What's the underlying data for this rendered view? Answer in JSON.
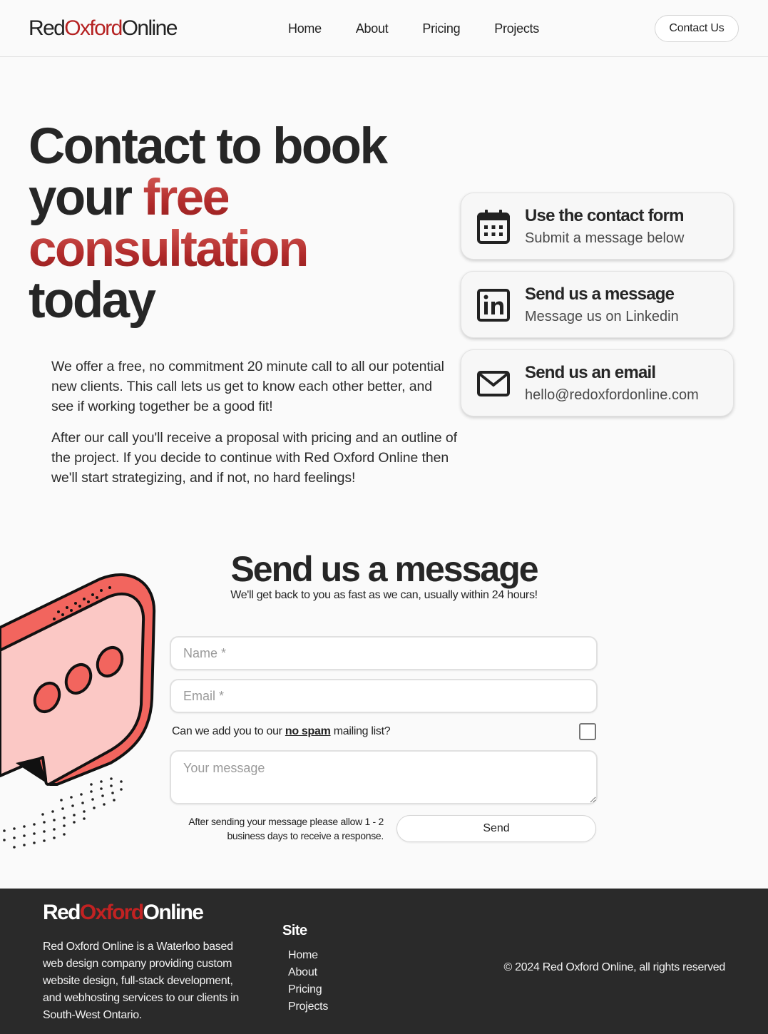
{
  "header": {
    "logo": {
      "part1": "Red",
      "part2": "Oxford",
      "part3": "Online"
    },
    "nav": [
      {
        "label": "Home"
      },
      {
        "label": "About"
      },
      {
        "label": "Pricing"
      },
      {
        "label": "Projects"
      }
    ],
    "contact_button": "Contact Us"
  },
  "hero": {
    "title_line1": "Contact to book",
    "title_line2_prefix": "your ",
    "title_highlight_1": "free",
    "title_highlight_2": "consultation",
    "title_line4": "today",
    "paragraphs": [
      "We offer a free, no commitment 20 minute call to all our potential new clients. This call lets us get to know each other better, and see if working together be a good fit!",
      "After our call you'll receive a proposal with pricing and an outline of the project. If you decide to continue with Red Oxford Online then we'll start strategizing, and if not, no hard feelings!"
    ]
  },
  "contact_cards": [
    {
      "title": "Use the contact form",
      "subtitle": "Submit a message below",
      "icon": "calendar-icon"
    },
    {
      "title": "Send us a message",
      "subtitle": "Message us on Linkedin",
      "icon": "linkedin-icon"
    },
    {
      "title": "Send us an email",
      "subtitle": "hello@redoxfordonline.com",
      "icon": "mail-icon"
    }
  ],
  "message_section": {
    "title": "Send us a message",
    "subtitle": "We'll get back to you as fast as we can, usually within 24 hours!",
    "name_placeholder": "Name *",
    "email_placeholder": "Email *",
    "checkbox_prefix": "Can we add you to our ",
    "checkbox_bold": "no spam",
    "checkbox_suffix": " mailing list?",
    "message_placeholder": "Your message",
    "note": "After sending your message please allow 1 - 2 business days to receive a response.",
    "send_label": "Send",
    "illustration": "chat-bubble-illustration"
  },
  "footer": {
    "logo": {
      "part1": "Red",
      "part2": "Oxford",
      "part3": "Online"
    },
    "description": "Red Oxford Online is a Waterloo based web design company providing custom website design, full-stack development, and webhosting services to our clients in South-West Ontario.",
    "site_heading": "Site",
    "links": [
      {
        "label": "Home"
      },
      {
        "label": "About"
      },
      {
        "label": "Pricing"
      },
      {
        "label": "Projects"
      }
    ],
    "copyright": "© 2024 Red Oxford Online, all rights reserved"
  },
  "colors": {
    "accent": "#b52222",
    "dark": "#262626",
    "footer_bg": "#2a2a2a",
    "bubble_pink": "#f9c7c4",
    "bubble_red": "#f2655e"
  }
}
